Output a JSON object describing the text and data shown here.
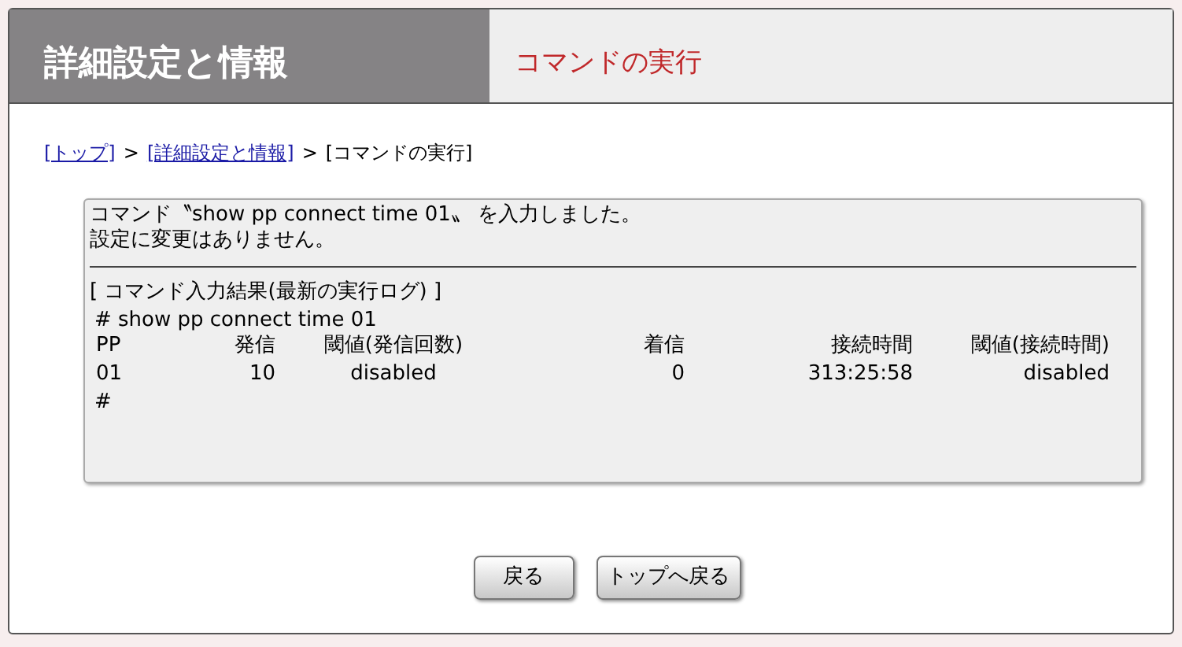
{
  "header": {
    "title": "詳細設定と情報",
    "subtitle": "コマンドの実行"
  },
  "breadcrumb": [
    {
      "kind": "link",
      "label": "[トップ]"
    },
    {
      "kind": "separator",
      "label": ">"
    },
    {
      "kind": "link",
      "label": "[詳細設定と情報]"
    },
    {
      "kind": "separator",
      "label": ">"
    },
    {
      "kind": "current",
      "label": "[コマンドの実行]"
    }
  ],
  "message": [
    "コマンド〝show pp connect time 01〟 を入力しました。",
    "設定に変更はありません。"
  ],
  "result": {
    "title": "[ コマンド入力結果(最新の実行ログ) ]",
    "command": "# show pp connect time 01",
    "columns": [
      "PP",
      "発信",
      "閾値(発信回数)",
      "着信",
      "接続時間",
      "閾値(接続時間)"
    ],
    "rows": [
      [
        "01",
        "10",
        "disabled",
        "0",
        "313:25:58",
        "disabled"
      ]
    ],
    "prompt": "#"
  },
  "buttons": [
    "戻る",
    "トップへ戻る"
  ]
}
